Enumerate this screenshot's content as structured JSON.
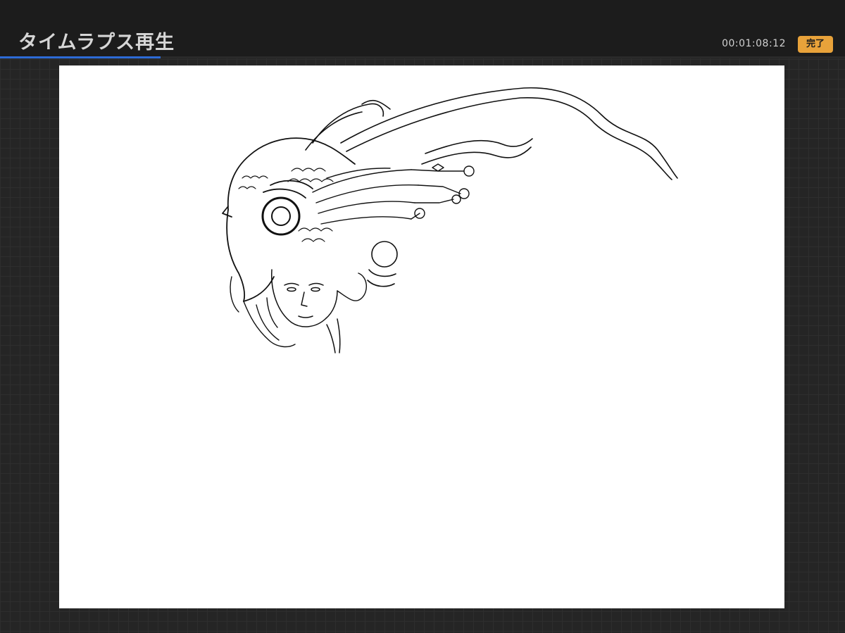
{
  "header": {
    "title": "タイムラプス再生",
    "timecode": "00:01:08:12",
    "done_label": "完了"
  },
  "playback": {
    "progress": 0.19
  },
  "colors": {
    "accent": "#2d6bd6",
    "done_button": "#e8a23a",
    "background": "#252525",
    "canvas": "#ffffff"
  },
  "canvas": {
    "content": "ink-sketch"
  }
}
